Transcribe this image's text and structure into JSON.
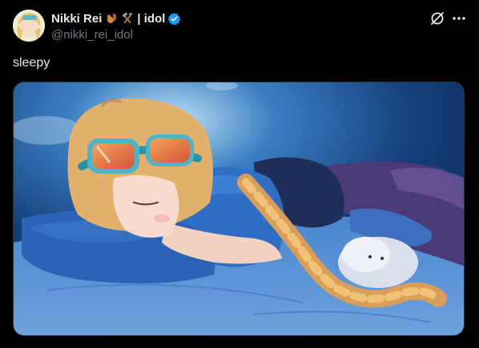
{
  "tweet": {
    "author": {
      "display_name": "Nikki Rei",
      "name_suffix": "| idol",
      "handle": "@nikki_rei_idol",
      "emoji_icons": [
        "squirrel-icon",
        "hammer-pick-icon"
      ],
      "verified": true,
      "verified_color": "#1d9bf0"
    },
    "text": "sleepy",
    "media": {
      "type": "image",
      "icons": [
        "grok-icon",
        "more-icon"
      ]
    }
  },
  "colors": {
    "background": "#000000",
    "text_primary": "#e7e9ea",
    "text_secondary": "#71767b",
    "accent": "#1d9bf0"
  }
}
